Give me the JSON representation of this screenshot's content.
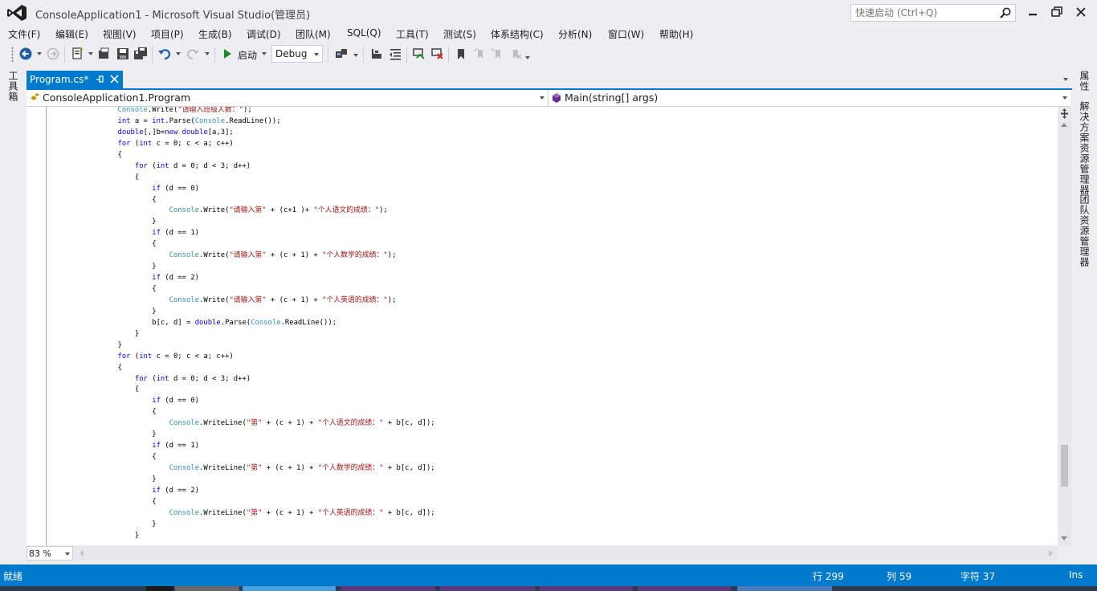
{
  "window": {
    "title": "ConsoleApplication1 - Microsoft Visual Studio(管理员)",
    "quick_launch_placeholder": "快速启动 (Ctrl+Q)"
  },
  "menu": [
    "文件(F)",
    "编辑(E)",
    "视图(V)",
    "项目(P)",
    "生成(B)",
    "调试(D)",
    "团队(M)",
    "SQL(Q)",
    "工具(T)",
    "测试(S)",
    "体系结构(C)",
    "分析(N)",
    "窗口(W)",
    "帮助(H)"
  ],
  "toolbar": {
    "start_label": "启动",
    "configuration": "Debug"
  },
  "side_panels": {
    "left": "工具箱",
    "right": [
      "属性",
      "解决方案资源管理器",
      "团队资源管理器"
    ]
  },
  "tab": {
    "label": "Program.cs*"
  },
  "navigation": {
    "class_scope": "ConsoleApplication1.Program",
    "member_scope": "Main(string[] args)"
  },
  "code_lines": [
    [
      [
        "ty",
        "Console"
      ],
      [
        "",
        "."
      ],
      [
        "",
        "Write("
      ],
      [
        "st",
        "\"请输入班级人数：\""
      ],
      [
        "",
        ");"
      ]
    ],
    [
      [
        "kw",
        "int"
      ],
      [
        "",
        " a = "
      ],
      [
        "kw",
        "int"
      ],
      [
        "",
        ".Parse("
      ],
      [
        "ty",
        "Console"
      ],
      [
        "",
        ".ReadLine());"
      ]
    ],
    [
      [
        "kw",
        "double"
      ],
      [
        "",
        "[,]b="
      ],
      [
        "kw",
        "new"
      ],
      [
        "",
        " "
      ],
      [
        "kw",
        "double"
      ],
      [
        "",
        "[a,3];"
      ]
    ],
    [
      [
        "kw",
        "for"
      ],
      [
        "",
        " ("
      ],
      [
        "kw",
        "int"
      ],
      [
        "",
        " c = 0; c < a; c++)"
      ]
    ],
    [
      [
        "",
        "{"
      ]
    ],
    [
      [
        "",
        "    "
      ],
      [
        "kw",
        "for"
      ],
      [
        "",
        " ("
      ],
      [
        "kw",
        "int"
      ],
      [
        "",
        " d = 0; d < 3; d++)"
      ]
    ],
    [
      [
        "",
        "    {"
      ]
    ],
    [
      [
        "",
        "        "
      ],
      [
        "kw",
        "if"
      ],
      [
        "",
        " (d == 0)"
      ]
    ],
    [
      [
        "",
        "        {"
      ]
    ],
    [
      [
        "",
        "            "
      ],
      [
        "ty",
        "Console"
      ],
      [
        "",
        ".Write("
      ],
      [
        "st",
        "\"请输入第\""
      ],
      [
        "",
        " + (c+1 )+ "
      ],
      [
        "st",
        "\"个人语文的成绩：\""
      ],
      [
        "",
        ");"
      ]
    ],
    [
      [
        "",
        "        }"
      ]
    ],
    [
      [
        "",
        "        "
      ],
      [
        "kw",
        "if"
      ],
      [
        "",
        " (d == 1)"
      ]
    ],
    [
      [
        "",
        "        {"
      ]
    ],
    [
      [
        "",
        "            "
      ],
      [
        "ty",
        "Console"
      ],
      [
        "",
        ".Write("
      ],
      [
        "st",
        "\"请输入第\""
      ],
      [
        "",
        " + (c + 1) + "
      ],
      [
        "st",
        "\"个人数学的成绩：\""
      ],
      [
        "",
        ");"
      ]
    ],
    [
      [
        "",
        "        }"
      ]
    ],
    [
      [
        "",
        "        "
      ],
      [
        "kw",
        "if"
      ],
      [
        "",
        " (d == 2)"
      ]
    ],
    [
      [
        "",
        "        {"
      ]
    ],
    [
      [
        "",
        "            "
      ],
      [
        "ty",
        "Console"
      ],
      [
        "",
        ".Write("
      ],
      [
        "st",
        "\"请输入第\""
      ],
      [
        "",
        " + (c + 1) + "
      ],
      [
        "st",
        "\"个人英语的成绩：\""
      ],
      [
        "",
        ");"
      ]
    ],
    [
      [
        "",
        "        }"
      ]
    ],
    [
      [
        "",
        "        b[c, d] = "
      ],
      [
        "kw",
        "double"
      ],
      [
        "",
        ".Parse("
      ],
      [
        "ty",
        "Console"
      ],
      [
        "",
        ".ReadLine());"
      ]
    ],
    [
      [
        "",
        "    }"
      ]
    ],
    [
      [
        "",
        "}"
      ]
    ],
    [
      [
        "kw",
        "for"
      ],
      [
        "",
        " ("
      ],
      [
        "kw",
        "int"
      ],
      [
        "",
        " c = 0; c < a; c++)"
      ]
    ],
    [
      [
        "",
        "{"
      ]
    ],
    [
      [
        "",
        "    "
      ],
      [
        "kw",
        "for"
      ],
      [
        "",
        " ("
      ],
      [
        "kw",
        "int"
      ],
      [
        "",
        " d = 0; d < 3; d++)"
      ]
    ],
    [
      [
        "",
        "    {"
      ]
    ],
    [
      [
        "",
        "        "
      ],
      [
        "kw",
        "if"
      ],
      [
        "",
        " (d == 0)"
      ]
    ],
    [
      [
        "",
        "        {"
      ]
    ],
    [
      [
        "",
        "            "
      ],
      [
        "ty",
        "Console"
      ],
      [
        "",
        ".WriteLine("
      ],
      [
        "st",
        "\"第\""
      ],
      [
        "",
        " + (c + 1) + "
      ],
      [
        "st",
        "\"个人语文的成绩：\""
      ],
      [
        "",
        " + b[c, d]);"
      ]
    ],
    [
      [
        "",
        "        }"
      ]
    ],
    [
      [
        "",
        "        "
      ],
      [
        "kw",
        "if"
      ],
      [
        "",
        " (d == 1)"
      ]
    ],
    [
      [
        "",
        "        {"
      ]
    ],
    [
      [
        "",
        "            "
      ],
      [
        "ty",
        "Console"
      ],
      [
        "",
        ".WriteLine("
      ],
      [
        "st",
        "\"第\""
      ],
      [
        "",
        " + (c + 1) + "
      ],
      [
        "st",
        "\"个人数学的成绩：\""
      ],
      [
        "",
        " + b[c, d]);"
      ]
    ],
    [
      [
        "",
        "        }"
      ]
    ],
    [
      [
        "",
        "        "
      ],
      [
        "kw",
        "if"
      ],
      [
        "",
        " (d == 2)"
      ]
    ],
    [
      [
        "",
        "        {"
      ]
    ],
    [
      [
        "",
        "            "
      ],
      [
        "ty",
        "Console"
      ],
      [
        "",
        ".WriteLine("
      ],
      [
        "st",
        "\"第\""
      ],
      [
        "",
        " + (c + 1) + "
      ],
      [
        "st",
        "\"个人英语的成绩：\""
      ],
      [
        "",
        " + b[c, d]);"
      ]
    ],
    [
      [
        "",
        "        }"
      ]
    ],
    [
      [
        "",
        "    }"
      ]
    ]
  ],
  "editor": {
    "zoom": "83 %"
  },
  "status": {
    "state": "就绪",
    "line": "行 299",
    "col": "列 59",
    "char": "字符 37",
    "mode": "Ins"
  },
  "colors": {
    "accent": "#007acc",
    "keyword": "#0000ff",
    "type": "#2b91af",
    "string": "#a31515",
    "logo": "#68217a"
  }
}
